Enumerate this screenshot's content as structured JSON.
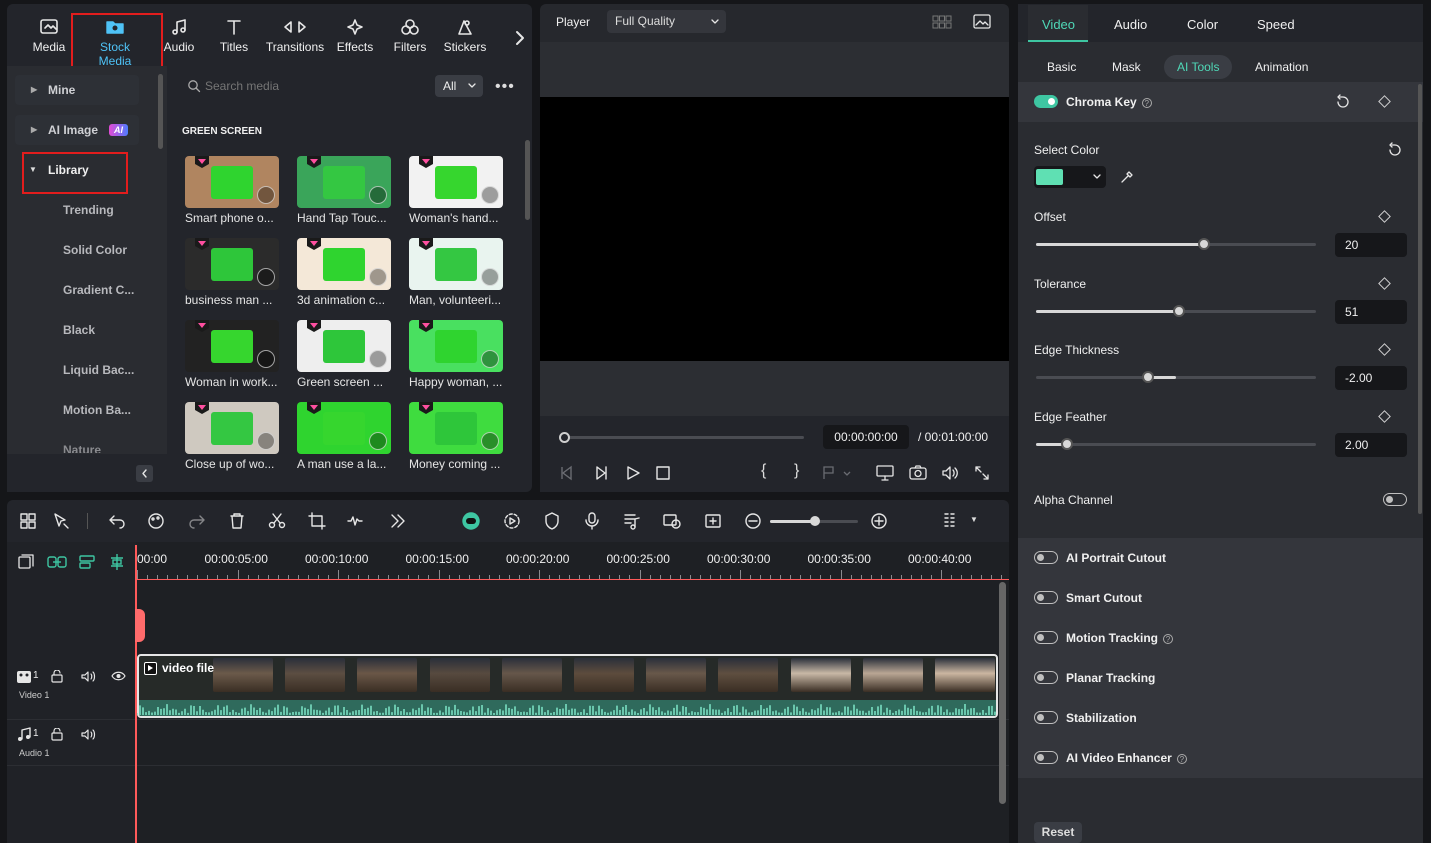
{
  "media_tabs": [
    {
      "label": "Media",
      "icon": "media-icon"
    },
    {
      "label": "Stock Media",
      "icon": "stock-media-icon"
    },
    {
      "label": "Audio",
      "icon": "audio-note-icon"
    },
    {
      "label": "Titles",
      "icon": "titles-icon"
    },
    {
      "label": "Transitions",
      "icon": "transitions-icon"
    },
    {
      "label": "Effects",
      "icon": "effects-icon"
    },
    {
      "label": "Filters",
      "icon": "filters-icon"
    },
    {
      "label": "Stickers",
      "icon": "stickers-icon"
    }
  ],
  "sidebar": {
    "mine": "Mine",
    "ai_image": "AI Image",
    "ai_badge": "AI",
    "library": "Library",
    "sub_items": [
      "Trending",
      "Solid Color",
      "Gradient C...",
      "Black",
      "Liquid Bac...",
      "Motion Ba...",
      "Nature"
    ]
  },
  "search": {
    "placeholder": "Search media",
    "filter": "All"
  },
  "section_title": "GREEN SCREEN",
  "thumbnails": [
    "Smart phone o...",
    "Hand Tap Touc...",
    "Woman's hand...",
    "business man ...",
    "3d animation c...",
    "Man, volunteeri...",
    "Woman in work...",
    "Green screen ...",
    "Happy woman, ...",
    "Close up of wo...",
    "A man use a la...",
    "Money coming ..."
  ],
  "player": {
    "label": "Player",
    "quality": "Full Quality",
    "current_time": "00:00:00:00",
    "total_time": "/ 00:01:00:00",
    "progress": 0
  },
  "timeline": {
    "ticks": [
      "00:00",
      "00:00:05:00",
      "00:00:10:00",
      "00:00:15:00",
      "00:00:20:00",
      "00:00:25:00",
      "00:00:30:00",
      "00:00:35:00",
      "00:00:40:00"
    ],
    "video_track": "Video 1",
    "video_num": "1",
    "audio_track": "Audio 1",
    "audio_num": "1",
    "clip_label": "video file"
  },
  "properties": {
    "tabs": [
      "Video",
      "Audio",
      "Color",
      "Speed"
    ],
    "subtabs": [
      "Basic",
      "Mask",
      "AI Tools",
      "Animation"
    ],
    "chroma_key": "Chroma Key",
    "select_color": "Select Color",
    "key_color": "#5fe0b3",
    "offset": {
      "label": "Offset",
      "value": "20",
      "fraction": 0.6
    },
    "tolerance": {
      "label": "Tolerance",
      "value": "51",
      "fraction": 0.51
    },
    "edge_thickness": {
      "label": "Edge Thickness",
      "value": "-2.00",
      "fraction": 0.4
    },
    "edge_feather": {
      "label": "Edge Feather",
      "value": "2.00",
      "fraction": 0.11
    },
    "alpha_channel": "Alpha Channel",
    "features": [
      "AI Portrait Cutout",
      "Smart Cutout",
      "Motion Tracking",
      "Planar Tracking",
      "Stabilization",
      "AI Video Enhancer"
    ],
    "reset": "Reset"
  },
  "colors": {
    "accent": "#3ec6a2",
    "highlight": "#e21d1d",
    "playhead": "#ff5a5a"
  }
}
